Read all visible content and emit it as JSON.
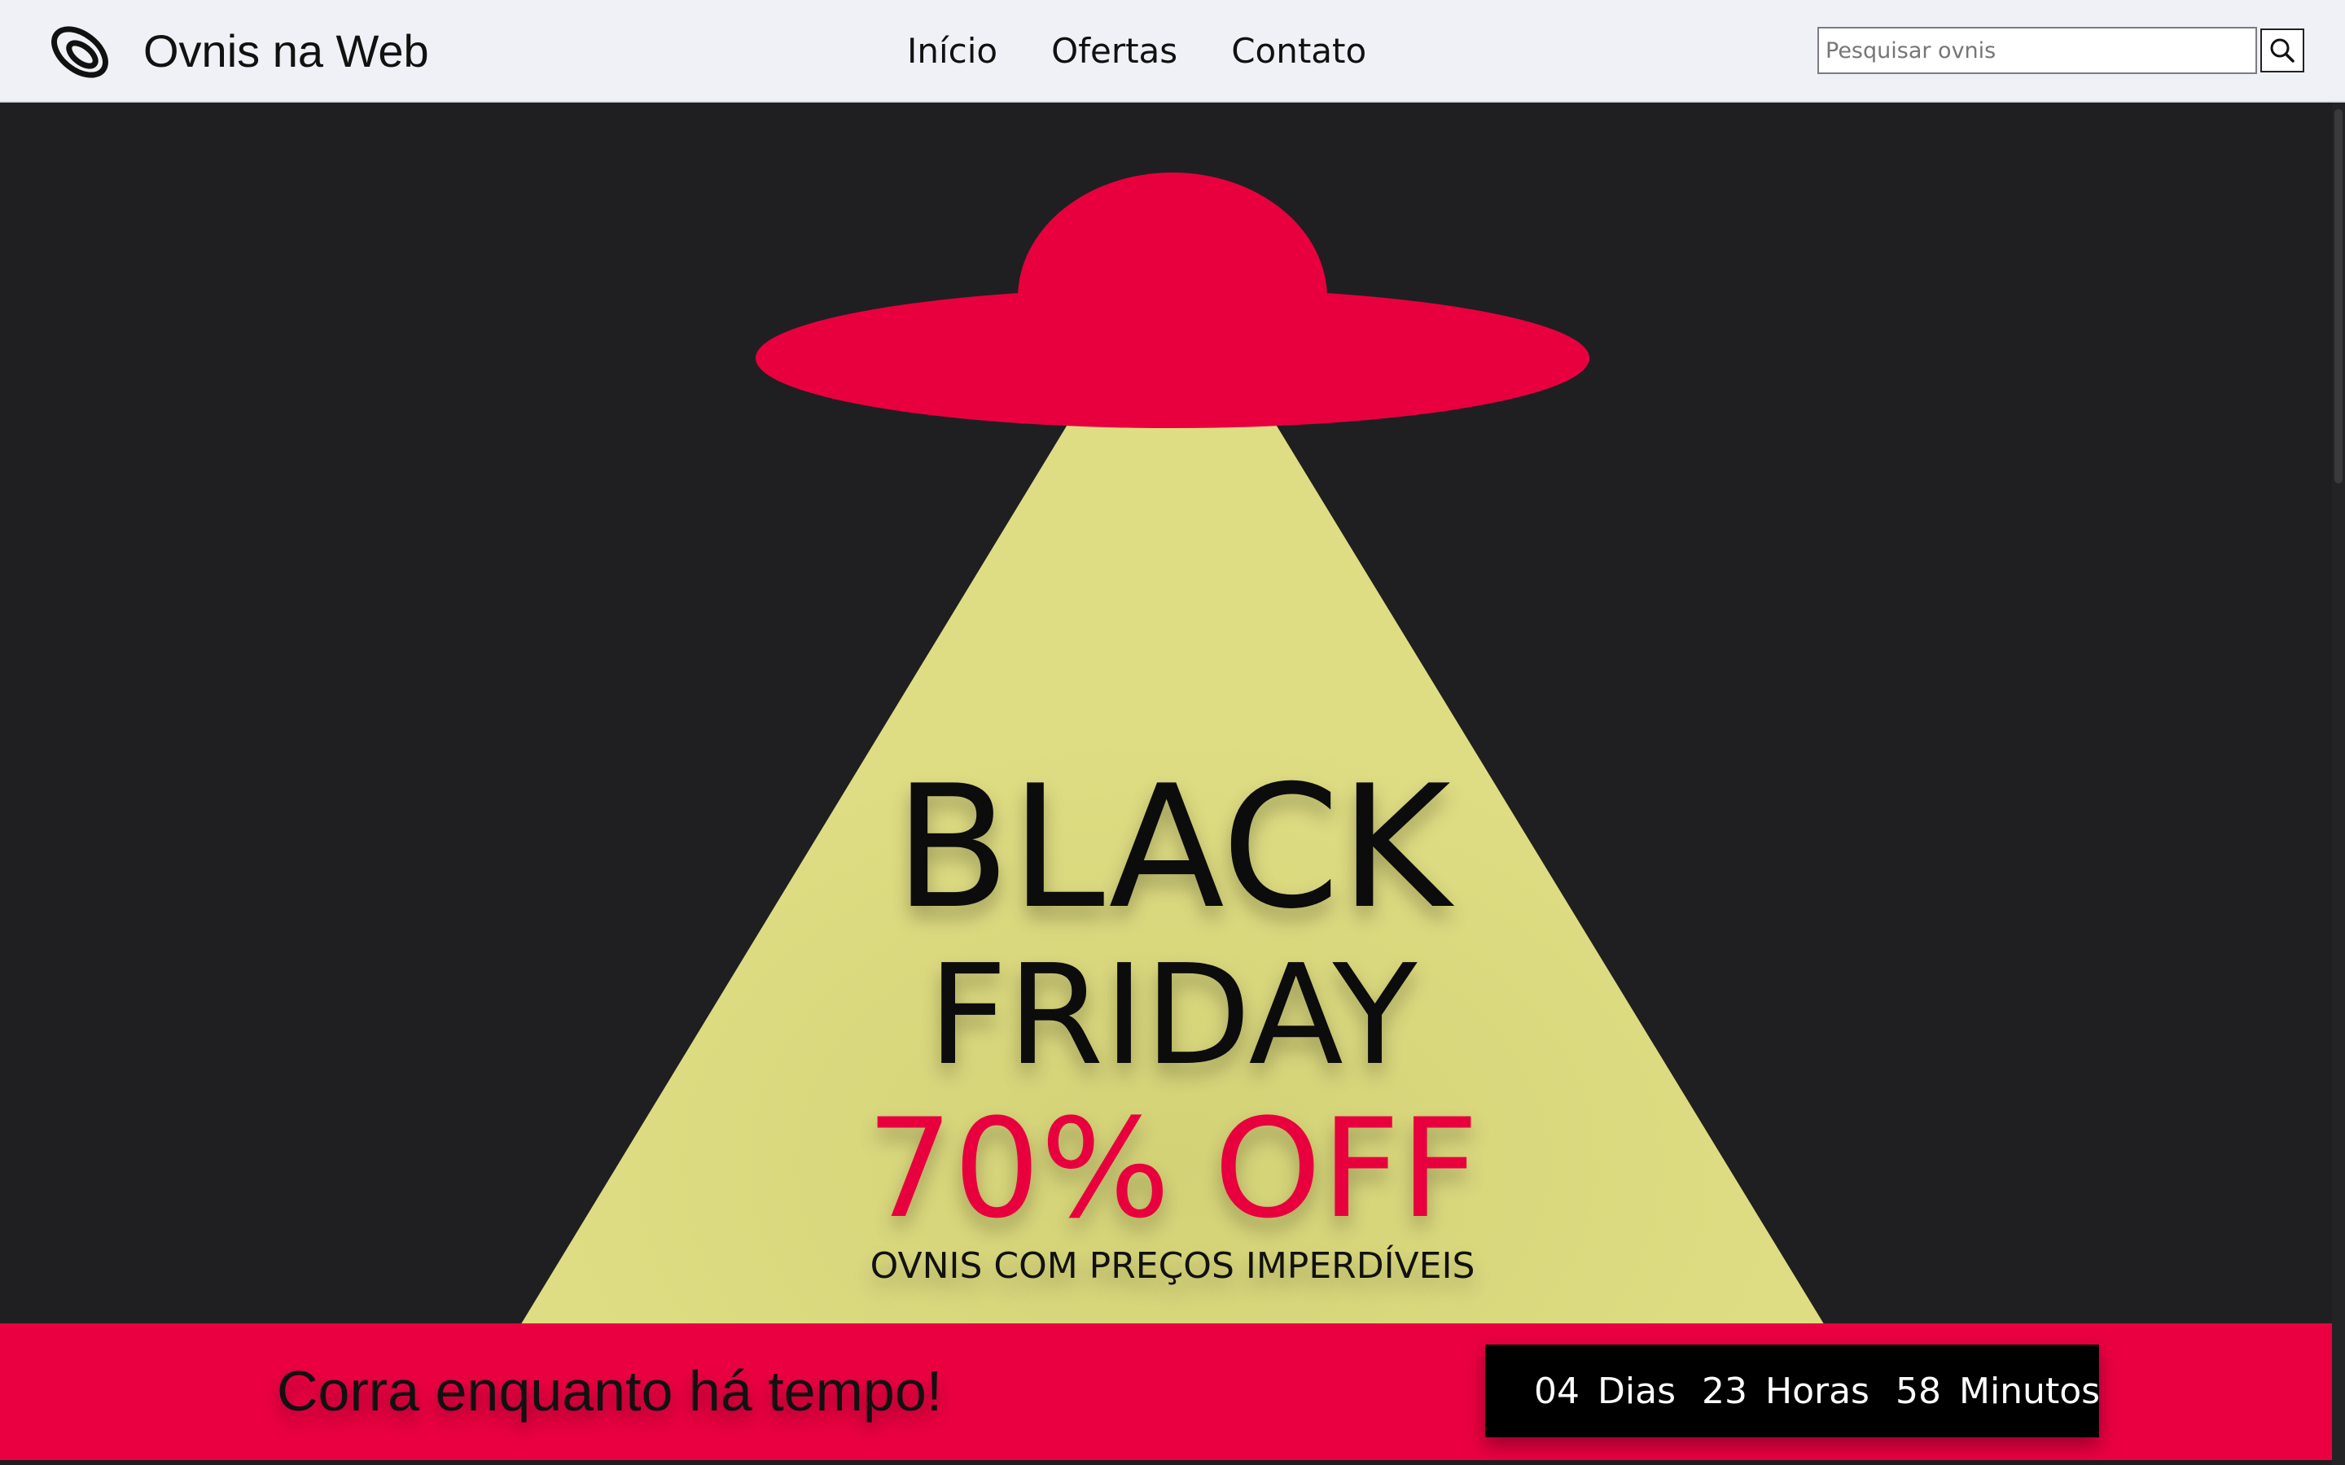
{
  "header": {
    "brand": "Ovnis na Web",
    "nav": [
      "Início",
      "Ofertas",
      "Contato"
    ],
    "search": {
      "placeholder": "Pesquisar ovnis",
      "value": ""
    },
    "search_button_icon": "search-icon",
    "logo_icon": "ufo-logo-icon"
  },
  "hero": {
    "title_line1": "BLACK",
    "title_line2": "FRIDAY",
    "discount": "70% OFF",
    "tagline": "OVNIS COM PREÇOS IMPERDÍVEIS"
  },
  "banner": {
    "message": "Corra enquanto há tempo!",
    "countdown": {
      "days": "04",
      "days_label": "Dias",
      "hours": "23",
      "hours_label": "Horas",
      "minutes": "58",
      "minutes_label": "Minutos"
    }
  },
  "colors": {
    "background": "#1f1f21",
    "header": "#f0f1f6",
    "accent": "#ea0041",
    "beam": "#dfdd83",
    "countdown_bg": "#000000"
  }
}
